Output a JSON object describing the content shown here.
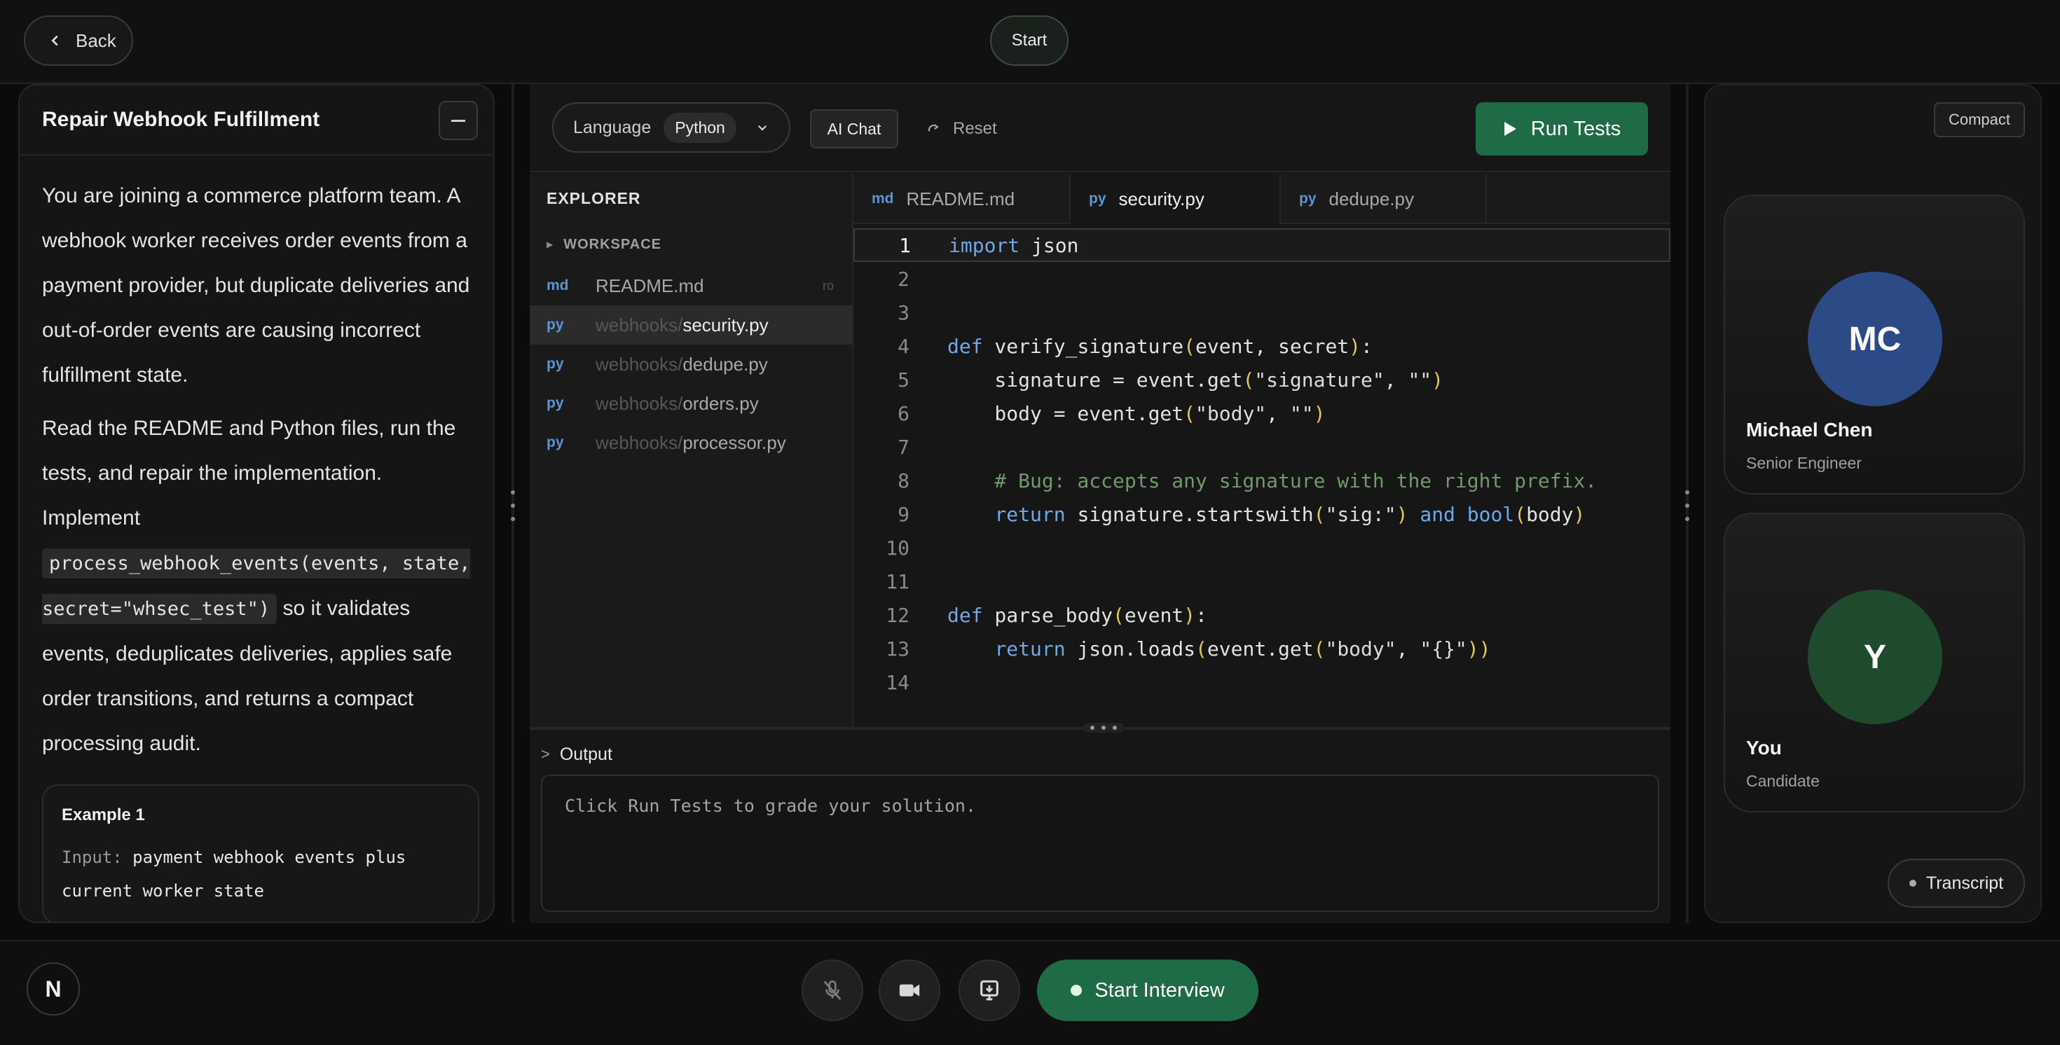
{
  "topbar": {
    "back_label": "Back",
    "start_label": "Start"
  },
  "problem": {
    "title": "Repair Webhook Fulfillment",
    "paragraph1": "You are joining a commerce platform team. A webhook worker receives order events from a payment provider, but duplicate deliveries and out-of-order events are causing incorrect fulfillment state.",
    "paragraph2_pre": "Read the README and Python files, run the tests, and repair the implementation. Implement",
    "paragraph2_code": "process_webhook_events(events, state, secret=\"whsec_test\")",
    "paragraph2_post": "so it validates events, deduplicates deliveries, applies safe order transitions, and returns a compact processing audit.",
    "example": {
      "title": "Example 1",
      "input_label": "Input:",
      "input_value": "payment webhook events plus current worker state"
    }
  },
  "toolbar": {
    "language_label": "Language",
    "language_value": "Python",
    "ai_chat_label": "AI Chat",
    "reset_label": "Reset",
    "run_tests_label": "Run Tests"
  },
  "explorer": {
    "title": "EXPLORER",
    "workspace_label": "WORKSPACE",
    "files": [
      {
        "ext": "md",
        "dir": "",
        "name": "README.md",
        "badge": "ro"
      },
      {
        "ext": "py",
        "dir": "webhooks/",
        "name": "security.py",
        "badge": ""
      },
      {
        "ext": "py",
        "dir": "webhooks/",
        "name": "dedupe.py",
        "badge": ""
      },
      {
        "ext": "py",
        "dir": "webhooks/",
        "name": "orders.py",
        "badge": ""
      },
      {
        "ext": "py",
        "dir": "webhooks/",
        "name": "processor.py",
        "badge": ""
      }
    ]
  },
  "tabs": [
    {
      "ext": "md",
      "name": "README.md"
    },
    {
      "ext": "py",
      "name": "security.py"
    },
    {
      "ext": "py",
      "name": "dedupe.py"
    }
  ],
  "code_lines": [
    {
      "n": "1",
      "text": "import json"
    },
    {
      "n": "2",
      "text": ""
    },
    {
      "n": "3",
      "text": ""
    },
    {
      "n": "4",
      "text": "def verify_signature(event, secret):"
    },
    {
      "n": "5",
      "text": "    signature = event.get(\"signature\", \"\")"
    },
    {
      "n": "6",
      "text": "    body = event.get(\"body\", \"\")"
    },
    {
      "n": "7",
      "text": ""
    },
    {
      "n": "8",
      "text": "    # Bug: accepts any signature with the right prefix."
    },
    {
      "n": "9",
      "text": "    return signature.startswith(\"sig:\") and bool(body)"
    },
    {
      "n": "10",
      "text": ""
    },
    {
      "n": "11",
      "text": ""
    },
    {
      "n": "12",
      "text": "def parse_body(event):"
    },
    {
      "n": "13",
      "text": "    return json.loads(event.get(\"body\", \"{}\"))"
    },
    {
      "n": "14",
      "text": ""
    }
  ],
  "output": {
    "label": "Output",
    "message": "Click Run Tests to grade your solution."
  },
  "right": {
    "compact_label": "Compact",
    "participants": [
      {
        "initials": "MC",
        "name": "Michael Chen",
        "role": "Senior Engineer",
        "color": "#2c4a86"
      },
      {
        "initials": "Y",
        "name": "You",
        "role": "Candidate",
        "color": "#1f4a2c"
      }
    ],
    "transcript_label": "Transcript"
  },
  "bottombar": {
    "logo_text": "N",
    "start_interview_label": "Start Interview"
  },
  "colors": {
    "accent_green": "#1f6b45",
    "keyword_blue": "#6fa8e6",
    "paren_yellow": "#e6c84c",
    "comment_green": "#6f9a6a"
  },
  "icons": [
    "chevron-left-icon",
    "chevron-down-icon",
    "reset-icon",
    "play-icon",
    "mic-off-icon",
    "video-icon",
    "screen-share-icon"
  ]
}
